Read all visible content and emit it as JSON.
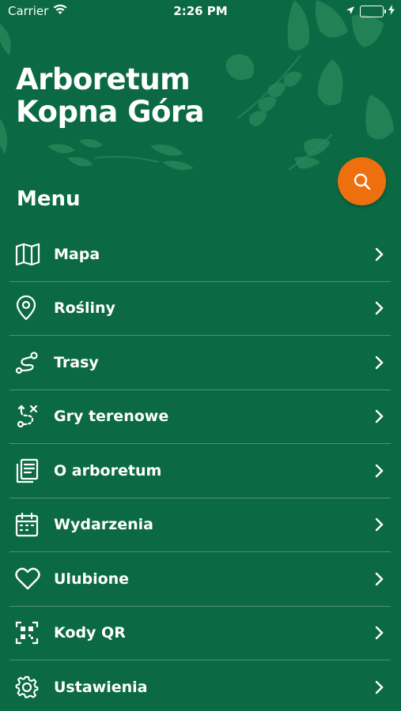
{
  "status_bar": {
    "carrier": "Carrier",
    "time": "2:26 PM",
    "icons": [
      "wifi-icon",
      "location-arrow-icon",
      "battery-icon",
      "charging-bolt-icon"
    ],
    "battery_color": "#4cd964"
  },
  "header": {
    "title_line1": "Arboretum",
    "title_line2": "Kopna Góra",
    "background_color": "#0b6a43"
  },
  "search_button": {
    "icon": "search-icon",
    "color": "#ee6f0d"
  },
  "menu": {
    "heading": "Menu",
    "items": [
      {
        "label": "Mapa",
        "icon": "map-icon"
      },
      {
        "label": "Rośliny",
        "icon": "location-pin-icon"
      },
      {
        "label": "Trasy",
        "icon": "route-icon"
      },
      {
        "label": "Gry terenowe",
        "icon": "field-game-icon"
      },
      {
        "label": "O arboretum",
        "icon": "document-icon"
      },
      {
        "label": "Wydarzenia",
        "icon": "calendar-icon"
      },
      {
        "label": "Ulubione",
        "icon": "heart-icon"
      },
      {
        "label": "Kody QR",
        "icon": "qr-code-icon"
      },
      {
        "label": "Ustawienia",
        "icon": "gear-icon"
      }
    ]
  }
}
